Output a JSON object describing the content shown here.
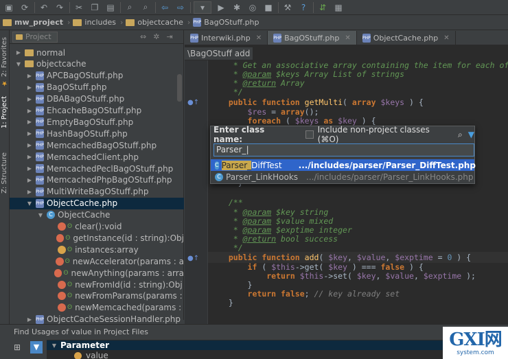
{
  "toolbar": {
    "icons": [
      "save-icon",
      "sync-icon",
      "undo-icon",
      "redo-icon",
      "cut-icon",
      "copy-icon",
      "paste-icon",
      "find-icon",
      "replace-icon",
      "back-icon",
      "forward-icon",
      "run-config-icon",
      "run-icon",
      "debug-icon",
      "coverage-icon",
      "stop-icon",
      "settings-icon",
      "help-icon",
      "vcs-icon",
      "terminal-icon"
    ]
  },
  "navbar": {
    "crumbs": [
      "mw_project",
      "includes",
      "objectcache",
      "BagOStuff.php"
    ]
  },
  "left_strip": {
    "favorites": "2: Favorites",
    "project": "1: Project",
    "structure": "Z: Structure"
  },
  "project": {
    "view_label": "Project",
    "tree": [
      {
        "label": "normal",
        "kind": "folder",
        "arrow": "▶"
      },
      {
        "label": "objectcache",
        "kind": "folder",
        "arrow": "▼"
      },
      {
        "label": "APCBagOStuff.php",
        "kind": "php",
        "arrow": "▶"
      },
      {
        "label": "BagOStuff.php",
        "kind": "php",
        "arrow": "▶"
      },
      {
        "label": "DBABagOStuff.php",
        "kind": "php",
        "arrow": "▶"
      },
      {
        "label": "EhcacheBagOStuff.php",
        "kind": "php",
        "arrow": "▶"
      },
      {
        "label": "EmptyBagOStuff.php",
        "kind": "php",
        "arrow": "▶"
      },
      {
        "label": "HashBagOStuff.php",
        "kind": "php",
        "arrow": "▶"
      },
      {
        "label": "MemcachedBagOStuff.php",
        "kind": "php",
        "arrow": "▶"
      },
      {
        "label": "MemcachedClient.php",
        "kind": "php",
        "arrow": "▶"
      },
      {
        "label": "MemcachedPeclBagOStuff.php",
        "kind": "php",
        "arrow": "▶"
      },
      {
        "label": "MemcachedPhpBagOStuff.php",
        "kind": "php",
        "arrow": "▶"
      },
      {
        "label": "MultiWriteBagOStuff.php",
        "kind": "php",
        "arrow": "▶"
      },
      {
        "label": "ObjectCache.php",
        "kind": "php",
        "arrow": "▼",
        "selected": true
      },
      {
        "label": "ObjectCache",
        "kind": "class",
        "arrow": "▼"
      },
      {
        "label": "clear():void",
        "kind": "method"
      },
      {
        "label": "getInstance(id : string):Obj",
        "kind": "method"
      },
      {
        "label": "instances:array",
        "kind": "field"
      },
      {
        "label": "newAccelerator(params : a",
        "kind": "method"
      },
      {
        "label": "newAnything(params : arra",
        "kind": "method"
      },
      {
        "label": "newFromId(id : string):Obj",
        "kind": "method"
      },
      {
        "label": "newFromParams(params :",
        "kind": "method"
      },
      {
        "label": "newMemcached(params :",
        "kind": "method"
      },
      {
        "label": "ObjectCacheSessionHandler.php",
        "kind": "php",
        "arrow": "▶"
      }
    ]
  },
  "editor_tabs": [
    {
      "label": "Interwiki.php",
      "active": false
    },
    {
      "label": "BagOStuff.php",
      "active": true
    },
    {
      "label": "ObjectCache.php",
      "active": false
    }
  ],
  "editor": {
    "breadcrumb_class": "\\BagOStuff",
    "breadcrumb_method": "add"
  },
  "popup": {
    "title": "Enter class name:",
    "checkbox_label": "Include non-project classes (⌘O)",
    "input_value": "Parser_",
    "results": [
      {
        "match": "Parser_",
        "rest": "DiffTest",
        "path": ".../includes/parser/Parser_DiffTest.php",
        "selected": true
      },
      {
        "match": "",
        "rest": "Parser_LinkHooks",
        "path": ".../includes/parser/Parser_LinkHooks.php",
        "selected": false
      }
    ]
  },
  "find_panel": {
    "title": "Find Usages of  value in Project Files",
    "rows": [
      "Parameter",
      "value"
    ]
  },
  "watermark": {
    "big": "GXI网",
    "small": "system.com"
  }
}
